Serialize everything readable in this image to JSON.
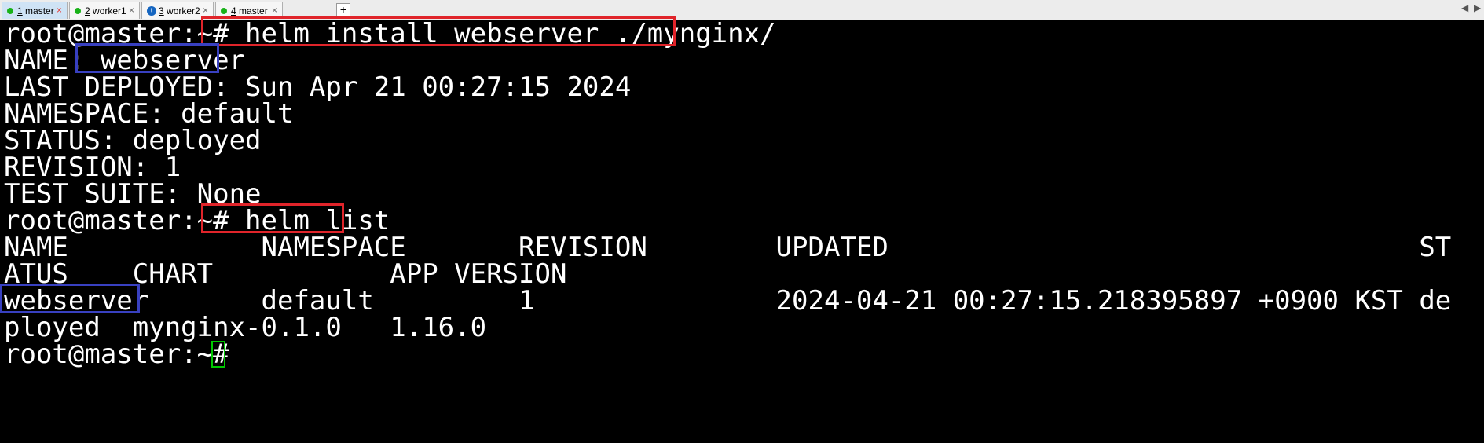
{
  "tabs": [
    {
      "num": "1",
      "label": "master",
      "active": true,
      "status": "green-dot"
    },
    {
      "num": "2",
      "label": "worker1",
      "active": false,
      "status": "green-dot"
    },
    {
      "num": "3",
      "label": "worker2",
      "active": false,
      "status": "info-icon"
    },
    {
      "num": "4",
      "label": "master",
      "active": false,
      "status": "green-dot"
    }
  ],
  "tab_close_glyph": "×",
  "add_tab_glyph": "+",
  "tab_status_info_glyph": "!",
  "scroll_arrows": {
    "left": "◀",
    "right": "▶"
  },
  "colors": {
    "background": "#000000",
    "foreground": "#ffffff",
    "command_highlight": "#e0242a",
    "name_highlight": "#3840c0",
    "cursor": "#00c800",
    "status_green": "#19b219"
  },
  "terminal": {
    "lines": [
      {
        "text": "root@master:~# helm install webserver ./mynginx/"
      },
      {
        "text": "NAME: webserver"
      },
      {
        "text": "LAST DEPLOYED: Sun Apr 21 00:27:15 2024"
      },
      {
        "text": "NAMESPACE: default"
      },
      {
        "text": "STATUS: deployed"
      },
      {
        "text": "REVISION: 1"
      },
      {
        "text": "TEST SUITE: None"
      },
      {
        "text": "root@master:~# helm list"
      },
      {
        "text": "NAME            NAMESPACE       REVISION        UPDATED                                 ST"
      },
      {
        "text": "ATUS    CHART           APP VERSION"
      },
      {
        "text": "webserver       default         1               2024-04-21 00:27:15.218395897 +0900 KST de"
      },
      {
        "text": "ployed  mynginx-0.1.0   1.16.0"
      },
      {
        "text": "root@master:~# "
      }
    ]
  }
}
